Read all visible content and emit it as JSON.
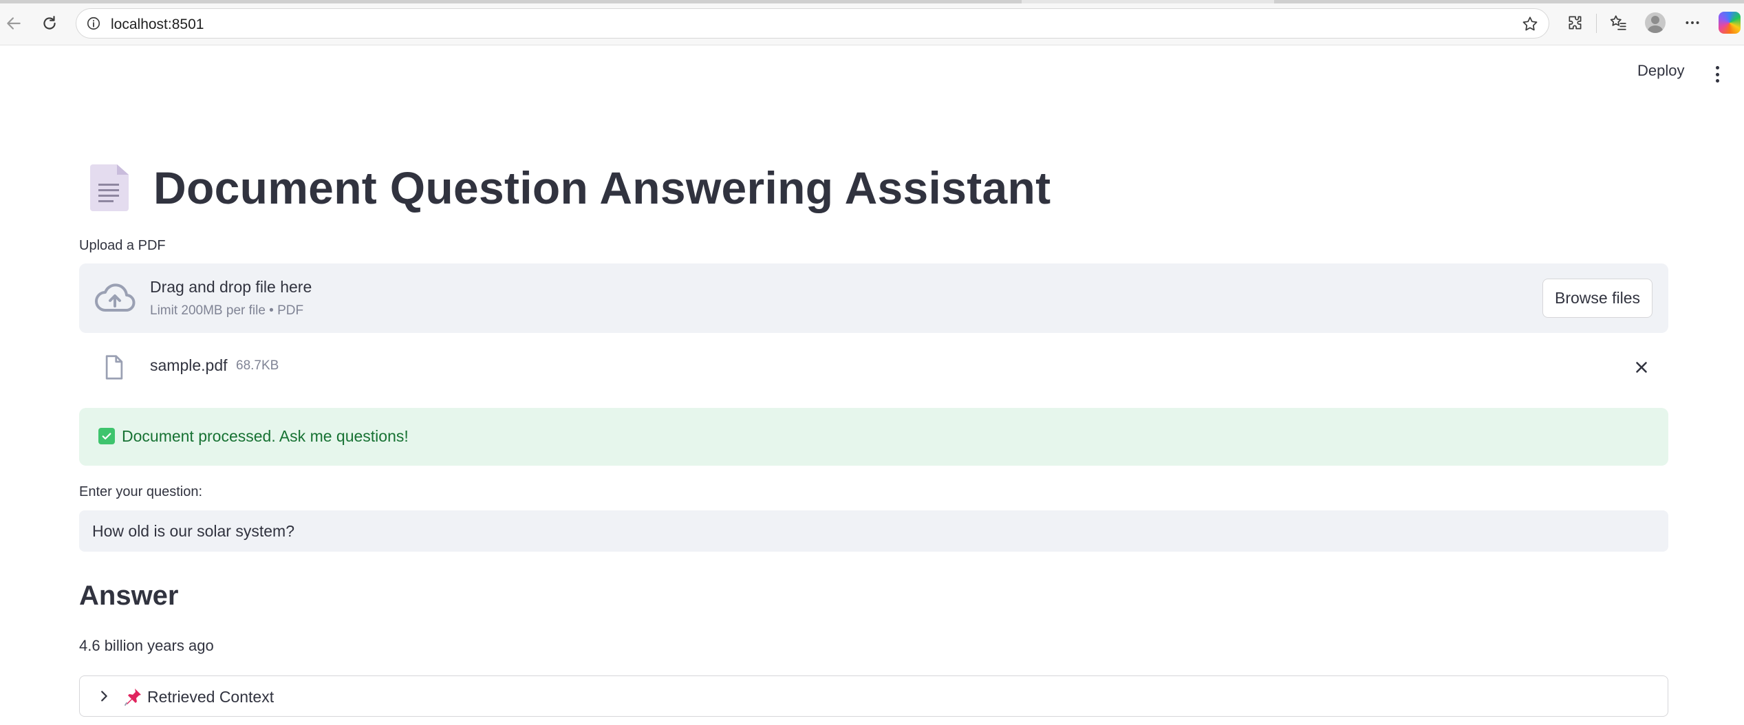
{
  "browser": {
    "url": "localhost:8501"
  },
  "header": {
    "deploy_label": "Deploy"
  },
  "main": {
    "title": "Document Question Answering Assistant",
    "title_icon": "page-facing-up-emoji",
    "upload": {
      "label": "Upload a PDF",
      "dropzone_title": "Drag and drop file here",
      "dropzone_limit": "Limit 200MB per file • PDF",
      "browse_label": "Browse files"
    },
    "uploaded_file": {
      "name": "sample.pdf",
      "size": "68.7KB"
    },
    "status": {
      "message": "Document processed. Ask me questions!",
      "color": "#177233"
    },
    "question": {
      "label": "Enter your question:",
      "value": "How old is our solar system?"
    },
    "answer": {
      "heading": "Answer",
      "text": "4.6 billion years ago"
    },
    "context_expander": {
      "label": "Retrieved Context",
      "expanded": false
    }
  },
  "colors": {
    "text": "#31333f",
    "muted": "#808495",
    "widget_bg": "#f0f2f6",
    "success_bg": "#e6f6ec",
    "success_icon": "#3ec46d"
  }
}
